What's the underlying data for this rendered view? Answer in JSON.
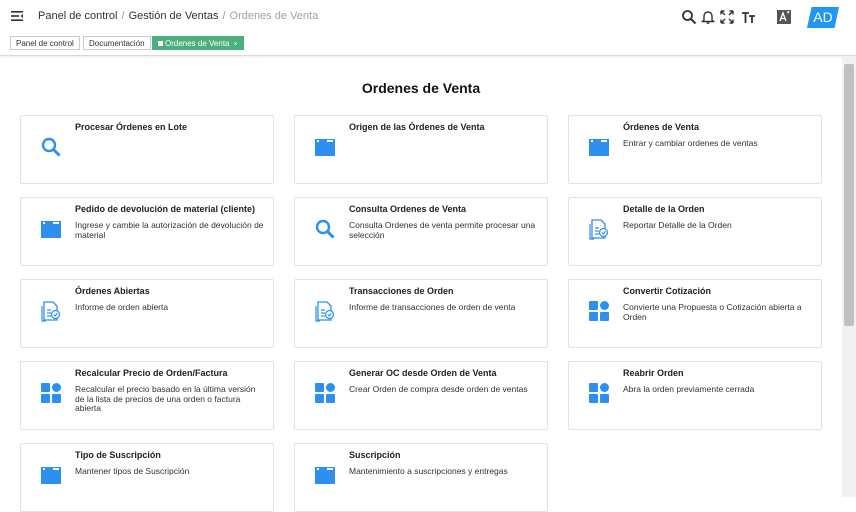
{
  "breadcrumb": {
    "items": [
      "Panel de control",
      "Gestión de Ventas"
    ],
    "separator": "/",
    "current": "Ordenes de Venta"
  },
  "header": {
    "icons": [
      "search-icon",
      "bell-icon",
      "fullscreen-icon",
      "font-size-icon",
      "translate-icon"
    ],
    "avatar": "AD",
    "accent_color": "#2196f3"
  },
  "tabs": [
    {
      "label": "Panel de control",
      "active": false
    },
    {
      "label": "Documentación",
      "active": false
    },
    {
      "label": "Ordenes de Venta",
      "active": true,
      "close": "×"
    }
  ],
  "page": {
    "title": "Ordenes de Venta"
  },
  "cards": [
    {
      "title": "Procesar Órdenes en Lote",
      "description": "",
      "icon": "search-icon"
    },
    {
      "title": "Origen de las Órdenes de Venta",
      "description": "",
      "icon": "window-icon"
    },
    {
      "title": "Órdenes de Venta",
      "description": "Entrar y cambiar ordenes de ventas",
      "icon": "window-icon"
    },
    {
      "title": "Pedido de devolución de material (cliente)",
      "description": "Ingrese y cambie la autorización de devolución de material",
      "icon": "window-icon"
    },
    {
      "title": "Consulta Ordenes de Venta",
      "description": "Consulta Ordenes de venta permite procesar una selección",
      "icon": "search-icon"
    },
    {
      "title": "Detalle de la Orden",
      "description": "Reportar Detalle de la Orden",
      "icon": "report-icon"
    },
    {
      "title": "Órdenes Abiertas",
      "description": "Informe de orden abierta",
      "icon": "report-icon"
    },
    {
      "title": "Transacciones de Orden",
      "description": "Informe de transacciones de orden de venta",
      "icon": "report-icon"
    },
    {
      "title": "Convertir Cotización",
      "description": "Convierte una Propuesta o Cotización abierta a Orden",
      "icon": "process-icon"
    },
    {
      "title": "Recalcular Precio de Orden/Factura",
      "description": "Recalcular el precio basado en la última versión de la lista de precios de una orden o factura abierta",
      "icon": "process-icon"
    },
    {
      "title": "Generar OC desde Orden de Venta",
      "description": "Crear Orden de compra desde orden de ventas",
      "icon": "process-icon"
    },
    {
      "title": "Reabrir Orden",
      "description": "Abra la orden previamente cerrada",
      "icon": "process-icon"
    },
    {
      "title": "Tipo de Suscripción",
      "description": "Mantener tipos de Suscripción",
      "icon": "window-icon"
    },
    {
      "title": "Suscripción",
      "description": "Mantenimiento a suscripciones y entregas",
      "icon": "window-icon"
    }
  ],
  "colors": {
    "icon_blue": "#2d8ff0",
    "active_tab": "#4caf7d"
  }
}
